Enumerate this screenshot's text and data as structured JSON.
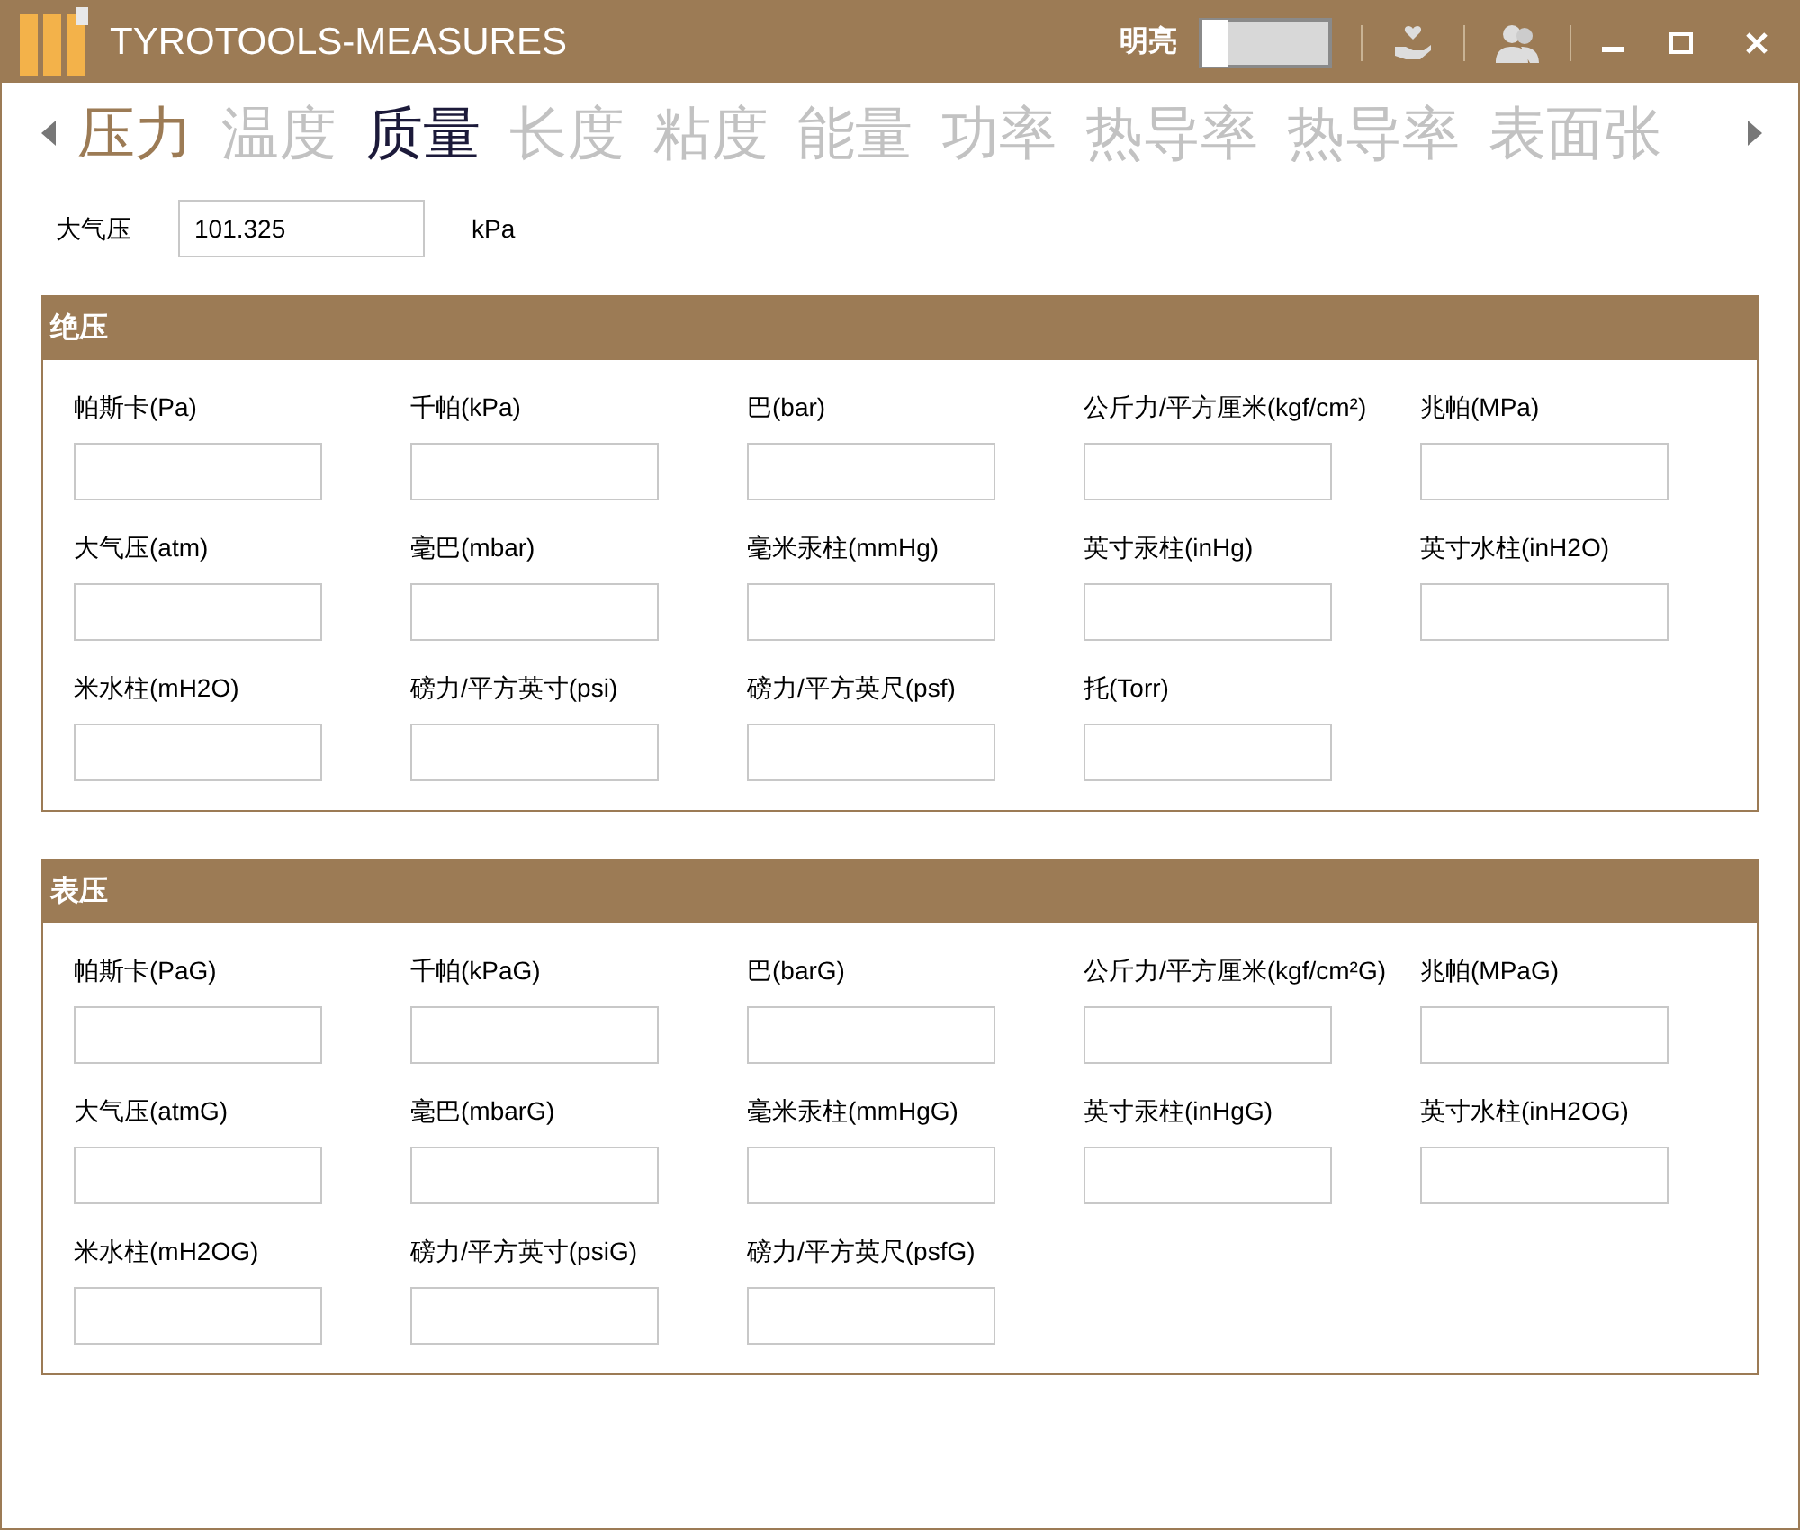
{
  "window": {
    "title": "TYROTOOLS-MEASURES"
  },
  "theme_toggle": {
    "label": "明亮",
    "on": false
  },
  "tabs": [
    {
      "label": "压力",
      "selected": true,
      "hovered": false
    },
    {
      "label": "温度",
      "selected": false,
      "hovered": false
    },
    {
      "label": "质量",
      "selected": false,
      "hovered": true
    },
    {
      "label": "长度",
      "selected": false,
      "hovered": false
    },
    {
      "label": "粘度",
      "selected": false,
      "hovered": false
    },
    {
      "label": "能量",
      "selected": false,
      "hovered": false
    },
    {
      "label": "功率",
      "selected": false,
      "hovered": false
    },
    {
      "label": "热导率",
      "selected": false,
      "hovered": false
    },
    {
      "label": "热导率",
      "selected": false,
      "hovered": false
    },
    {
      "label": "表面张",
      "selected": false,
      "hovered": false
    }
  ],
  "atmosphere": {
    "label": "大气压",
    "value": "101.325",
    "unit": "kPa"
  },
  "sections": [
    {
      "title": "绝压",
      "fields": [
        {
          "label": "帕斯卡(Pa)"
        },
        {
          "label": "千帕(kPa)"
        },
        {
          "label": "巴(bar)"
        },
        {
          "label": "公斤力/平方厘米(kgf/cm²)"
        },
        {
          "label": "兆帕(MPa)"
        },
        {
          "label": "大气压(atm)"
        },
        {
          "label": "毫巴(mbar)"
        },
        {
          "label": "毫米汞柱(mmHg)"
        },
        {
          "label": "英寸汞柱(inHg)"
        },
        {
          "label": "英寸水柱(inH2O)"
        },
        {
          "label": "米水柱(mH2O)"
        },
        {
          "label": "磅力/平方英寸(psi)"
        },
        {
          "label": "磅力/平方英尺(psf)"
        },
        {
          "label": "托(Torr)"
        }
      ]
    },
    {
      "title": "表压",
      "fields": [
        {
          "label": "帕斯卡(PaG)"
        },
        {
          "label": "千帕(kPaG)"
        },
        {
          "label": "巴(barG)"
        },
        {
          "label": "公斤力/平方厘米(kgf/cm²G)"
        },
        {
          "label": "兆帕(MPaG)"
        },
        {
          "label": "大气压(atmG)"
        },
        {
          "label": "毫巴(mbarG)"
        },
        {
          "label": "毫米汞柱(mmHgG)"
        },
        {
          "label": "英寸汞柱(inHgG)"
        },
        {
          "label": "英寸水柱(inH2OG)"
        },
        {
          "label": "米水柱(mH2OG)"
        },
        {
          "label": "磅力/平方英寸(psiG)"
        },
        {
          "label": "磅力/平方英尺(psfG)"
        }
      ]
    }
  ]
}
